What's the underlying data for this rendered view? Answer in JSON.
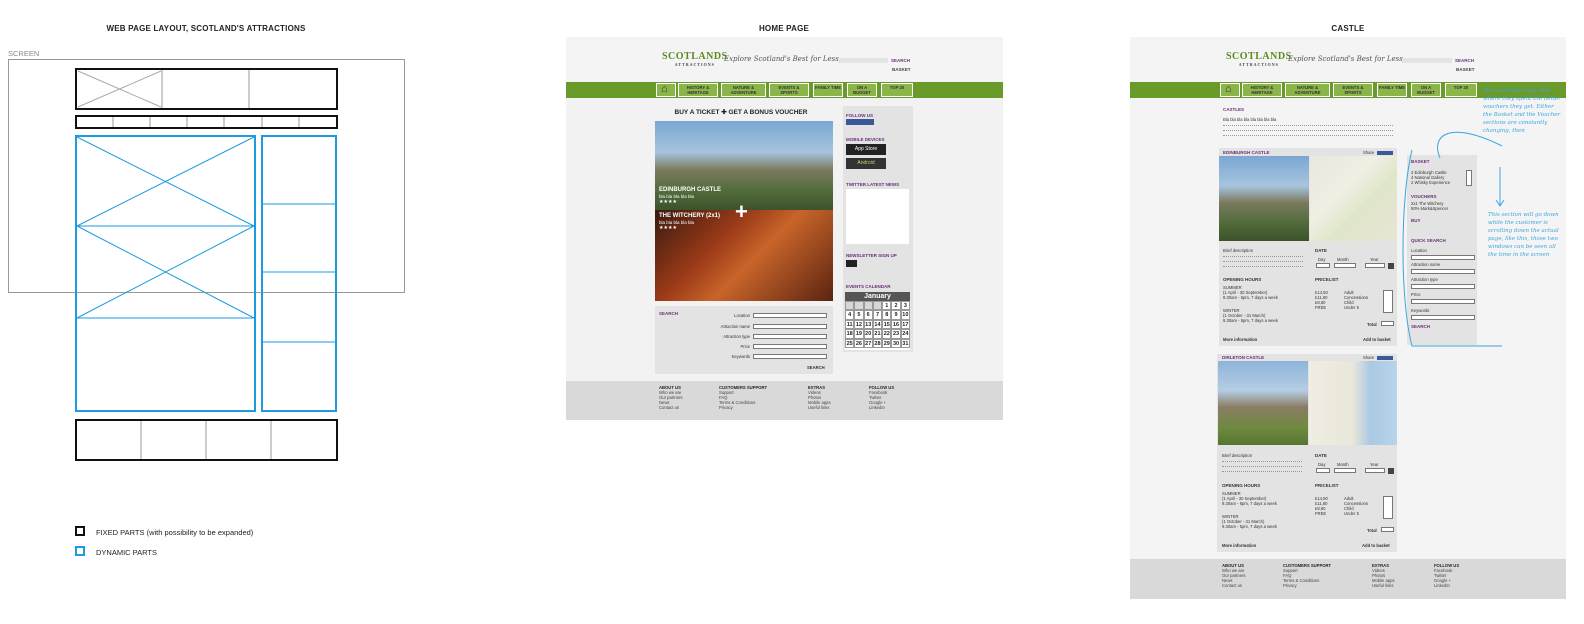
{
  "titles": {
    "layout": "WEB PAGE LAYOUT, SCOTLAND'S ATTRACTIONS",
    "home": "HOME PAGE",
    "castle": "CASTLE"
  },
  "screen_label": "SCREEN",
  "legend": {
    "fixed": "FIXED PARTS (with possibility to be expanded)",
    "dynamic": "DYNAMIC PARTS",
    "fixed_color": "#111111",
    "dynamic_color": "#1e9be0"
  },
  "brand": {
    "logo_main": "SCOTLANDS",
    "logo_sub": "ATTRACTIONS",
    "tagline": "Explore Scotland's Best for Less",
    "search_label": "SEARCH",
    "basket_label": "BASKET",
    "accent": "#6a9a2a",
    "purple": "#6a2d7a"
  },
  "nav": [
    "HISTORY & HERITAGE",
    "NATURE & ADVENTURE",
    "EVENTS & SPORTS",
    "FAMILY TIME",
    "ON A BUDGET",
    "TOP 20"
  ],
  "home": {
    "promo_title": "BUY A TICKET  ✚  GET A BONUS VOUCHER",
    "hero1_title": "EDINBURGH CASTLE",
    "hero1_text": "bla bla bla bla bla",
    "hero1_stars": "★★★★",
    "hero2_title": "THE WITCHERY (2x1)",
    "hero2_text": "bla bla bla bla bla",
    "hero2_stars": "★★★★",
    "search_title": "SEARCH",
    "search_fields": [
      "Location",
      "Attraction name",
      "Attraction type",
      "Price",
      "Keywords"
    ],
    "search_button": "SEARCH",
    "follow_us": "FOLLOW US",
    "mobile_devices": "MOBILE DEVICES",
    "app_store": "App Store",
    "android": "Android",
    "twitter_news": "TWITTER LATEST NEWS",
    "newsletter": "NEWSLETTER SIGN UP",
    "events_calendar": "EVENTS CALENDAR",
    "calendar_month": "January",
    "calendar_rows": [
      [
        "",
        "",
        "",
        "",
        "1",
        "2",
        "3"
      ],
      [
        "4",
        "5",
        "6",
        "7",
        "8",
        "9",
        "10"
      ],
      [
        "11",
        "12",
        "13",
        "14",
        "15",
        "16",
        "17"
      ],
      [
        "18",
        "19",
        "20",
        "21",
        "22",
        "23",
        "24"
      ],
      [
        "25",
        "26",
        "27",
        "28",
        "29",
        "30",
        "31"
      ]
    ]
  },
  "footer": {
    "about_title": "ABOUT US",
    "about_items": [
      "Who we are",
      "Our partners",
      "News",
      "Contact us"
    ],
    "support_title": "CUSTOMERS SUPPORT",
    "support_items": [
      "Support",
      "FAQ",
      "Terms & Conditions",
      "Privacy"
    ],
    "extras_title": "EXTRAS",
    "extras_items": [
      "Videos",
      "Photos",
      "Mobile apps",
      "Useful links"
    ],
    "follow_title": "FOLLOW US",
    "follow_items": [
      "Facebook",
      "Twitter",
      "Google +",
      "LinkedIn"
    ]
  },
  "castle": {
    "section_title": "CASTLES",
    "section_text": "Bla bla bla bla bla bla bla bla",
    "share": "Share",
    "items": [
      {
        "name": "EDINBURGH CASTLE",
        "brief": "Brief description",
        "date": "DATE",
        "day": "Day",
        "month": "Month",
        "year": "Year",
        "opening": "OPENING HOURS",
        "summer": "SUMMER",
        "summer_range": "(1 April - 30 September)",
        "summer_hours": "9.30am - 6pm, 7 days a week",
        "winter": "WINTER",
        "winter_range": "(1 October - 31 March)",
        "winter_hours": "9.30am - 5pm, 7 days a week",
        "pricelist": "PRICELIST",
        "prices": [
          "£14,50",
          "£11,60",
          "£8,60",
          "FREE"
        ],
        "types": [
          "Adult",
          "Concessions",
          "Child",
          "Under 5"
        ],
        "total": "Total",
        "more": "More information",
        "add": "Add to basket"
      },
      {
        "name": "DIRLETON CASTLE",
        "brief": "Brief description",
        "date": "DATE",
        "day": "Day",
        "month": "Month",
        "year": "Year",
        "opening": "OPENING HOURS",
        "summer": "SUMMER",
        "summer_range": "(1 April - 30 September)",
        "summer_hours": "9.30am - 6pm, 7 days a week",
        "winter": "WINTER",
        "winter_range": "(1 October - 31 March)",
        "winter_hours": "9.30am - 5pm, 7 days a week",
        "pricelist": "PRICELIST",
        "prices": [
          "£14,50",
          "£11,60",
          "£8,60",
          "FREE"
        ],
        "types": [
          "Adult",
          "Concessions",
          "Child",
          "Under 5"
        ],
        "total": "Total",
        "more": "More information",
        "add": "Add to basket"
      }
    ],
    "basket_title": "BASKET",
    "basket_items": [
      "2  Edinburgh Castle",
      "4  National Gallery",
      "2  Whisky Experience"
    ],
    "vouchers_title": "VOUCHERS",
    "vouchers_items": [
      "2x1    The Witchery",
      "50%   Mark&Spencer"
    ],
    "buy": "BUY",
    "quick_search": "QUICK SEARCH",
    "qs_fields": [
      "Location",
      "Attraction name",
      "Attraction type",
      "Price",
      "Keywords"
    ],
    "qs_button": "SEARCH",
    "note1": "The customers may find where they spent the better vouchers they get. Either the Basket and the Voucher sections are constantly changing, then",
    "note2": "This section will go down while the customer is scrolling down the actual page, like this, those two windows can be seen all the time in the screen"
  }
}
